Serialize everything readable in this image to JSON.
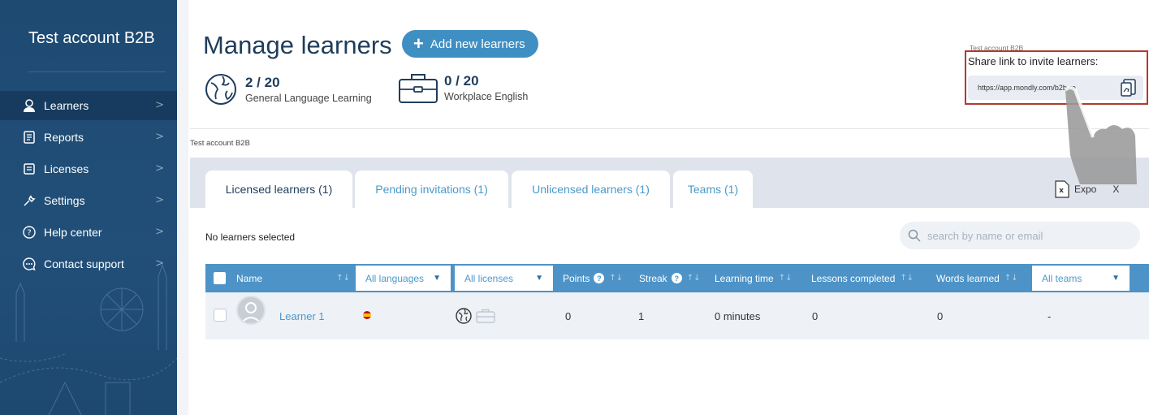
{
  "sidebar": {
    "title": "Test account B2B",
    "items": [
      {
        "label": "Learners",
        "icon": "user-icon"
      },
      {
        "label": "Reports",
        "icon": "reports-icon"
      },
      {
        "label": "Licenses",
        "icon": "licenses-icon"
      },
      {
        "label": "Settings",
        "icon": "settings-icon"
      },
      {
        "label": "Help center",
        "icon": "help-icon"
      },
      {
        "label": "Contact support",
        "icon": "chat-icon"
      }
    ],
    "chevron": ">"
  },
  "header": {
    "title": "Manage learners",
    "add_button": "Add new learners",
    "licenses": [
      {
        "count": "2 / 20",
        "name": "General Language Learning",
        "icon": "globe-icon"
      },
      {
        "count": "0 / 20",
        "name": "Workplace English",
        "icon": "briefcase-icon"
      }
    ]
  },
  "share": {
    "account": "Test account B2B",
    "title": "Share link to invite learners:",
    "url": "https://app.mondly.com/b2b-re\t"
  },
  "breadcrumb": "Test account B2B",
  "tabs": [
    {
      "label": "Licensed learners (1)",
      "active": true
    },
    {
      "label": "Pending invitations (1)",
      "active": false
    },
    {
      "label": "Unlicensed learners (1)",
      "active": false
    },
    {
      "label": "Teams (1)",
      "active": false
    }
  ],
  "export_label": "Expo      X",
  "selection_status": "No learners selected",
  "search": {
    "placeholder": "search by name or email"
  },
  "table": {
    "columns": {
      "name": "Name",
      "languages": "All languages",
      "licenses": "All licenses",
      "points": "Points",
      "streak": "Streak",
      "learning_time": "Learning time",
      "lessons_completed": "Lessons completed",
      "words_learned": "Words learned",
      "teams": "All teams"
    },
    "help_glyph": "?",
    "sort_glyph": "↑↓",
    "rows": [
      {
        "name": "Learner 1",
        "language_flag": "spain-flag",
        "points": "0",
        "streak": "1",
        "learning_time": "0 minutes",
        "lessons_completed": "0",
        "words_learned": "0",
        "team": "-"
      }
    ]
  },
  "colors": {
    "sidebar": "#1e4a72",
    "accent": "#4d93c7",
    "highlight_box": "#b23a2e"
  }
}
